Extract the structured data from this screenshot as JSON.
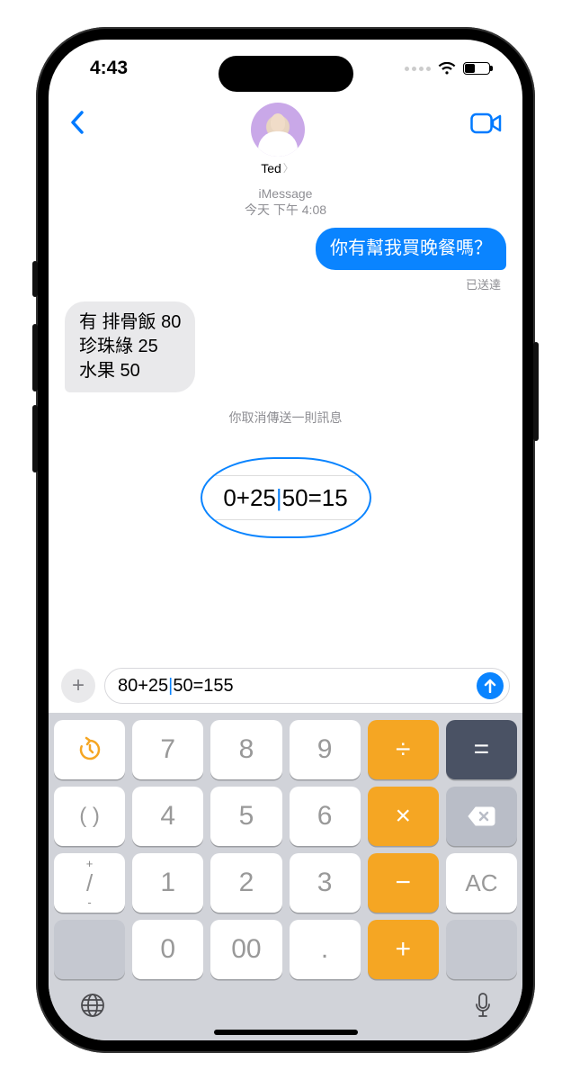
{
  "status": {
    "time": "4:43"
  },
  "header": {
    "contact_name": "Ted"
  },
  "thread": {
    "service": "iMessage",
    "timestamp": "今天 下午 4:08",
    "sent_bubble": "你有幫我買晚餐嗎？",
    "receipt": "已送達",
    "received_bubble": "有 排骨飯 80\n珍珠綠 25\n水果 50",
    "system": "你取消傳送一則訊息"
  },
  "loupe": {
    "left": "0+25",
    "right": "50=15"
  },
  "input": {
    "text_left": "80+25",
    "text_right": "50=155"
  },
  "keyboard": {
    "r1": {
      "k1_icon": "history-icon",
      "k2": "7",
      "k3": "8",
      "k4": "9",
      "k5": "÷",
      "k6": "="
    },
    "r2": {
      "k1": "( )",
      "k2": "4",
      "k3": "5",
      "k4": "6",
      "k5": "×",
      "k6_icon": "backspace-icon"
    },
    "r3": {
      "k1_top": "+",
      "k1_mid": "/",
      "k1_bot": "-",
      "k2": "1",
      "k3": "2",
      "k4": "3",
      "k5": "−",
      "k6": "AC"
    },
    "r4": {
      "k2": "0",
      "k3": "00",
      "k4": ".",
      "k5": "+"
    }
  }
}
